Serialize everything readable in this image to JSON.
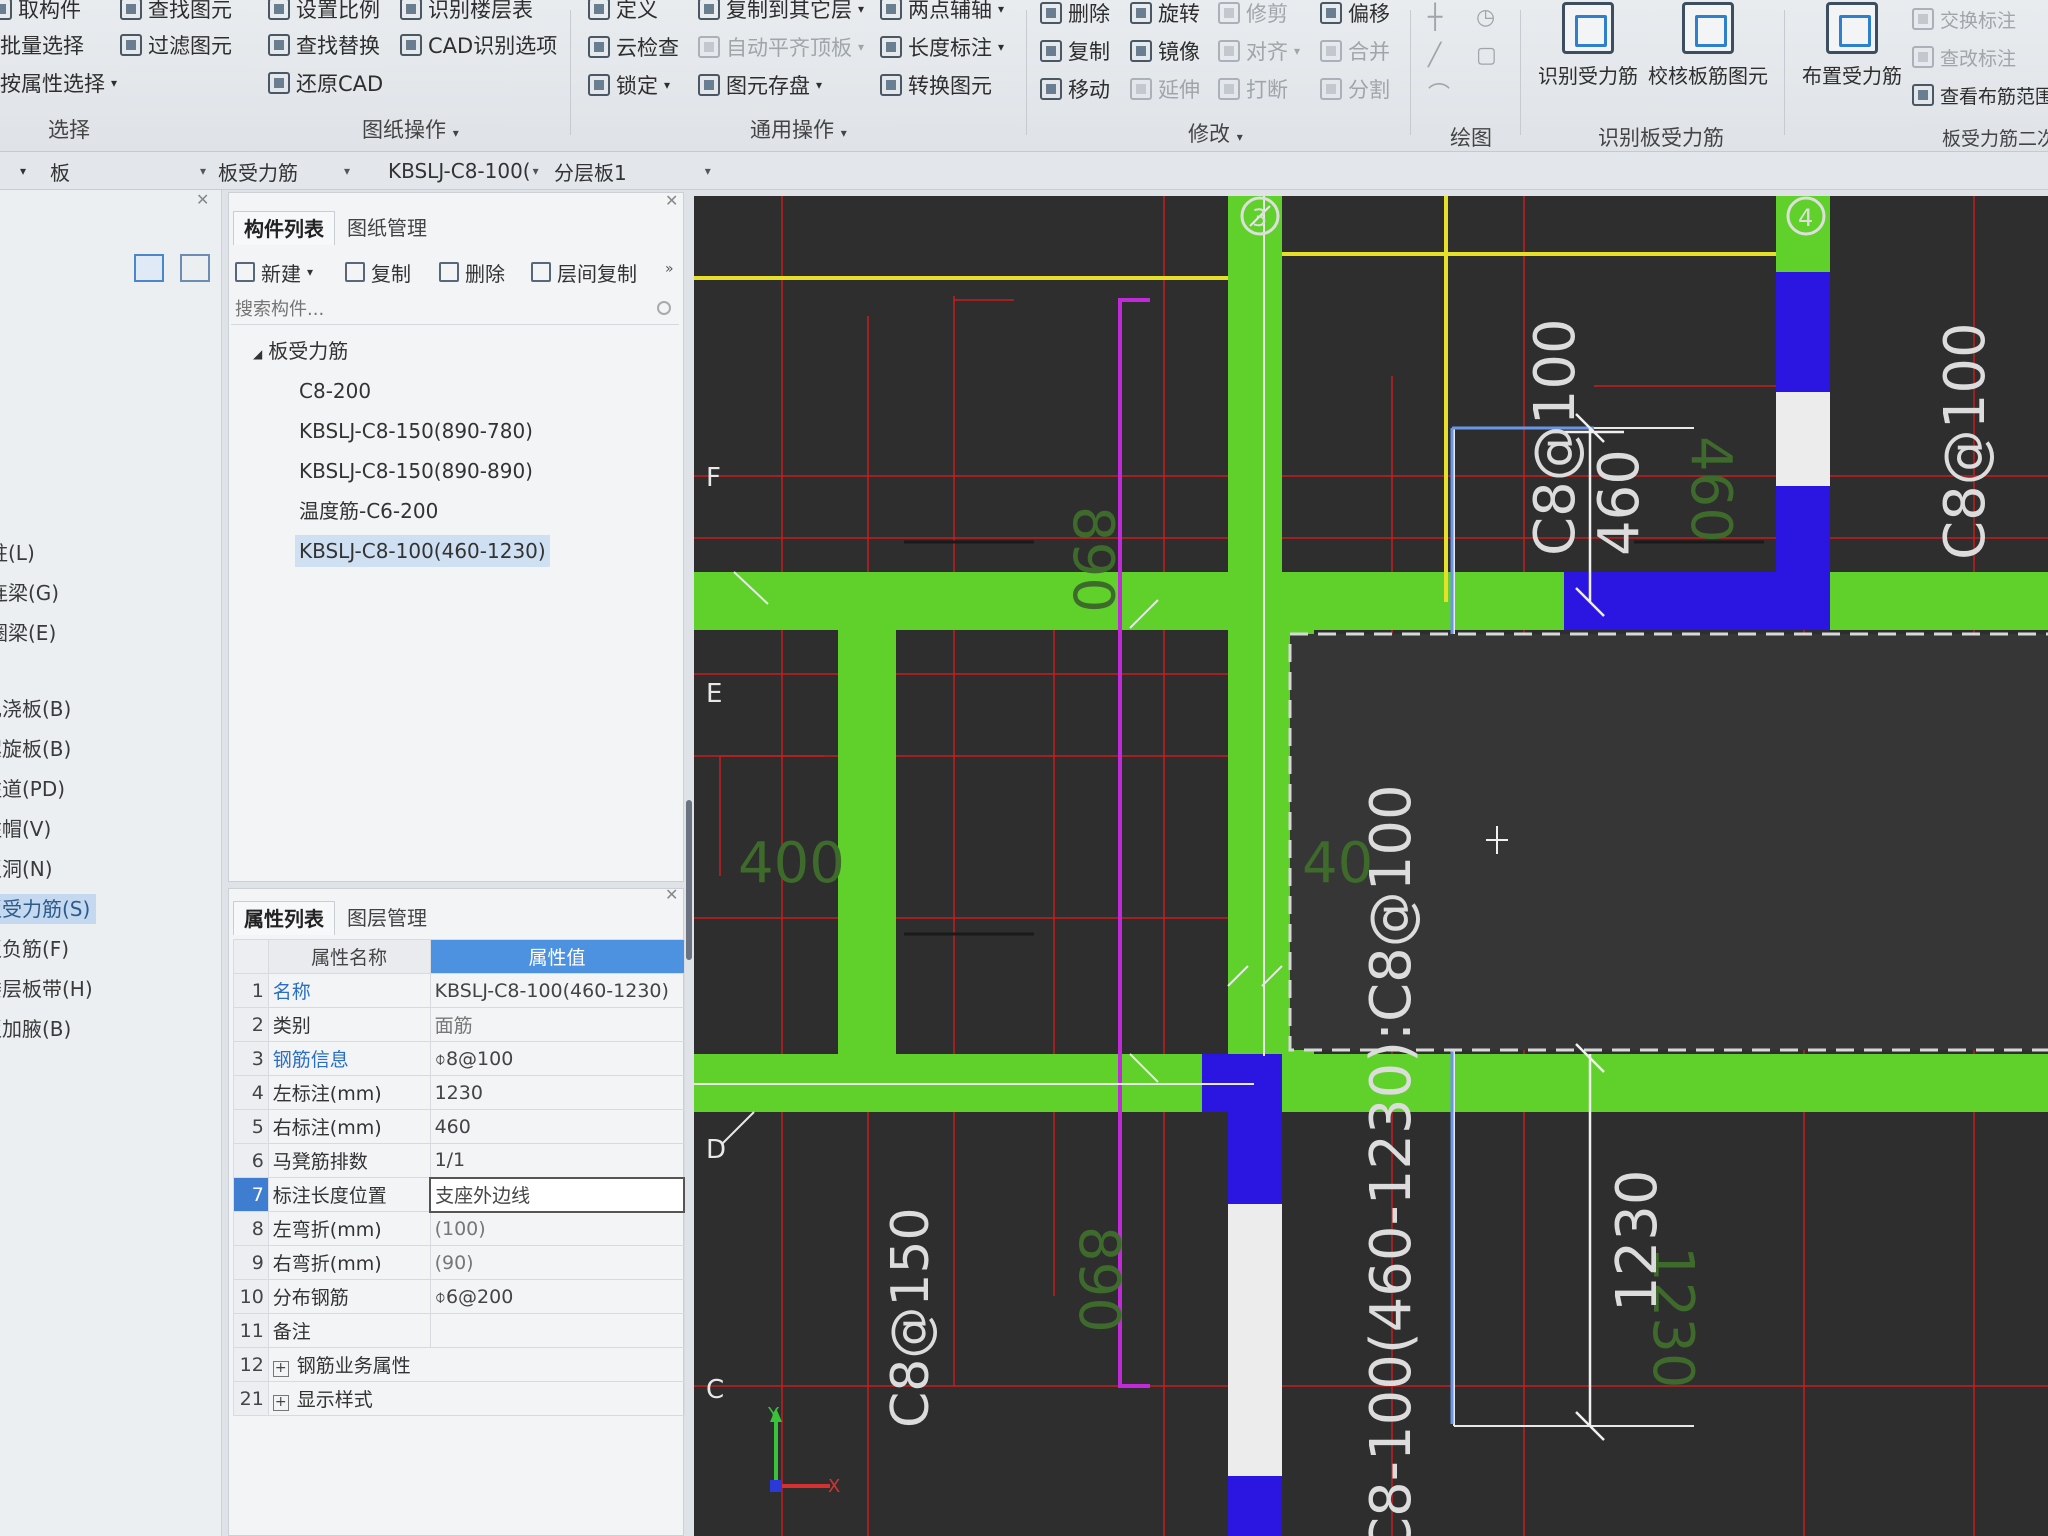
{
  "ribbon": {
    "col1": [
      "取构件",
      "批量选择",
      "按属性选择"
    ],
    "col2": [
      "查找图元",
      "过滤图元"
    ],
    "col3": [
      "设置比例",
      "查找替换",
      "还原CAD"
    ],
    "col4": [
      "识别楼层表",
      "CAD识别选项"
    ],
    "col5": [
      "定义",
      "云检查",
      "锁定"
    ],
    "col6": [
      "复制到其它层",
      "自动平齐顶板",
      "图元存盘"
    ],
    "col7": [
      "两点辅轴",
      "长度标注",
      "转换图元"
    ],
    "col8": [
      "删除",
      "复制",
      "移动"
    ],
    "col9": [
      "旋转",
      "镜像",
      "延伸"
    ],
    "col10": [
      "修剪",
      "对齐",
      "打断"
    ],
    "col11": [
      "偏移",
      "合并",
      "分割"
    ],
    "big": [
      "识别受力筋",
      "校核板筋图元",
      "布置受力筋"
    ],
    "col12": [
      "交换标注",
      "查改标注",
      "查看布筋范围"
    ],
    "groups": {
      "select": "选择",
      "drawing_ops": "图纸操作",
      "common_ops": "通用操作",
      "modify": "修改",
      "draw": "绘图",
      "recognize": "识别板受力筋",
      "rebar2": "板受力筋二次"
    }
  },
  "selectors": [
    "板",
    "板受力筋",
    "KBSLJ-C8-100(",
    "分层板1"
  ],
  "left_nav": [
    "柱(L)",
    "连梁(G)",
    "圈梁(E)",
    "现浇板(B)",
    "螺旋板(B)",
    "柱道(PD)",
    "柱帽(V)",
    "板洞(N)",
    "板受力筋(S)",
    "板负筋(F)",
    "楼层板带(H)",
    "板加腋(B)"
  ],
  "comp_panel": {
    "tabs": [
      "构件列表",
      "图纸管理"
    ],
    "toolbar": [
      "新建",
      "复制",
      "删除",
      "层间复制"
    ],
    "search_placeholder": "搜索构件...",
    "tree_root": "板受力筋",
    "tree_items": [
      "C8-200",
      "KBSLJ-C8-150(890-780)",
      "KBSLJ-C8-150(890-890)",
      "温度筋-C6-200",
      "KBSLJ-C8-100(460-1230)"
    ]
  },
  "prop_panel": {
    "tabs": [
      "属性列表",
      "图层管理"
    ],
    "header_name": "属性名称",
    "header_value": "属性值",
    "rows": [
      {
        "num": "1",
        "name": "名称",
        "value": "KBSLJ-C8-100(460-1230)"
      },
      {
        "num": "2",
        "name": "类别",
        "value": "面筋"
      },
      {
        "num": "3",
        "name": "钢筋信息",
        "value": "⌽8@100"
      },
      {
        "num": "4",
        "name": "左标注(mm)",
        "value": "1230"
      },
      {
        "num": "5",
        "name": "右标注(mm)",
        "value": "460"
      },
      {
        "num": "6",
        "name": "马凳筋排数",
        "value": "1/1"
      },
      {
        "num": "7",
        "name": "标注长度位置",
        "value": "支座外边线"
      },
      {
        "num": "8",
        "name": "左弯折(mm)",
        "value": "(100)"
      },
      {
        "num": "9",
        "name": "右弯折(mm)",
        "value": "(90)"
      },
      {
        "num": "10",
        "name": "分布钢筋",
        "value": "⌽6@200"
      },
      {
        "num": "11",
        "name": "备注",
        "value": ""
      },
      {
        "num": "12",
        "name": "钢筋业务属性",
        "value": ""
      },
      {
        "num": "21",
        "name": "显示样式",
        "value": ""
      }
    ]
  },
  "canvas": {
    "axis_labels": [
      "F",
      "E",
      "D",
      "C"
    ],
    "grid_numbers": [
      "3",
      "4"
    ],
    "annotations": [
      "C8@100",
      "460",
      "C8@100",
      "C8-100(460-1230):C8@100",
      "1230",
      "C8@150",
      "400",
      "40"
    ],
    "ghost_text": [
      "890",
      "460",
      "890",
      "1230"
    ],
    "ucs": [
      "Y",
      "X"
    ]
  }
}
